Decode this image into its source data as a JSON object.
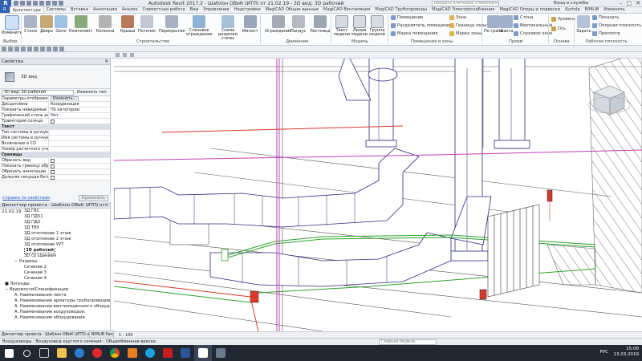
{
  "titlebar": {
    "title": "Autodesk Revit 2017.2 -   Шаблон ОВиК (ИТП) от 21.02.19 - 3D вид: 3D рабочий",
    "search_placeholder": "Введите ключевое слово/фразу",
    "login": "Вход в службы"
  },
  "tabs": [
    "Архитектура",
    "Системы",
    "Вставка",
    "Аннотации",
    "Анализ",
    "Совместная работа",
    "Вид",
    "Управление",
    "Надстройки",
    "MagiCAD Общие данные",
    "MagiCAD Вентиляция",
    "MagiCAD Трубопроводы",
    "MagiCAD Электроснабжение",
    "MagiCAD Опоры и подвески",
    "Kurtolp",
    "BIMLIB",
    "Изменить"
  ],
  "ribbon": {
    "modify": "Изменить",
    "build": [
      "Стена",
      "Дверь",
      "Окно",
      "Компонент",
      "Колонна",
      "Крыша",
      "Потолок",
      "Перекрытие",
      "Стеновое ограждение",
      "Схема разрезки стены",
      "Импост"
    ],
    "move": [
      "Ограждение",
      "Пандус",
      "Лестница"
    ],
    "model": [
      "Текст модели",
      "Линия модели",
      "Группа модели"
    ],
    "rooms_small": [
      "Помещение",
      "Разделитель помещений",
      "Марка помещения",
      "Зона",
      "Граница зоны",
      "Марка зоны"
    ],
    "opening": [
      "По грани",
      "Шахта"
    ],
    "opening_small": [
      "Стена",
      "Вертикальный",
      "Слуховое окно"
    ],
    "datum": [
      "Уровень",
      "Ось"
    ],
    "workplane": [
      "Задать",
      "Показать",
      "Опорная плоскость",
      "Просмотр"
    ],
    "panel_labels": [
      "Выбор",
      "Строительство",
      "Движение",
      "Модель",
      "Помещения и зоны",
      "Проем",
      "Основа",
      "Рабочая плоскость"
    ]
  },
  "properties": {
    "header": "Свойства",
    "type_name": "3D вид",
    "selector": "3D вид: 3D рабочий",
    "edit_type": "Изменить тип",
    "rows": [
      {
        "k": "Параметры отображен...",
        "v": "Изменить...",
        "kind": "btn"
      },
      {
        "k": "Дисциплина",
        "v": "Координация"
      },
      {
        "k": "Показать невидимые ли...",
        "v": "По категории"
      },
      {
        "k": "Графический стиль рас...",
        "v": "Нет"
      },
      {
        "k": "Траектория солнца",
        "v": "",
        "kind": "cb"
      },
      {
        "k": "Текст",
        "v": "",
        "kind": "grp"
      },
      {
        "k": "Тип системы в ручную",
        "v": ""
      },
      {
        "k": "Имя системы в ручную",
        "v": ""
      },
      {
        "k": "Включение в СО",
        "v": ""
      },
      {
        "k": "Номер расчетного учас...",
        "v": ""
      },
      {
        "k": "Границы",
        "v": "",
        "kind": "grp"
      },
      {
        "k": "Обрезать вид",
        "v": "",
        "kind": "cb"
      },
      {
        "k": "Показать границу обре...",
        "v": "",
        "kind": "cb"
      },
      {
        "k": "Обрезать аннотации",
        "v": "",
        "kind": "cb"
      },
      {
        "k": "Дальняя секущая Вкл",
        "v": "",
        "kind": "cb"
      }
    ],
    "help_link": "Справка по свойствам",
    "apply": "Применить"
  },
  "browser": {
    "header": "Диспетчер проекта - Шаблон ОВиК (ИТП) от 21.02.19",
    "items": [
      {
        "t": "3Д ГВС",
        "lvl": 3
      },
      {
        "t": "3Д ПД51",
        "lvl": 3
      },
      {
        "t": "3Д ПД2",
        "lvl": 3
      },
      {
        "t": "3Д ТВУ",
        "lvl": 3
      },
      {
        "t": "3Д отопление 1 этаж",
        "lvl": 3
      },
      {
        "t": "3Д отопление 2 этаж",
        "lvl": 3
      },
      {
        "t": "3Д отопление УУТ",
        "lvl": 3
      },
      {
        "t": "3D рабочий",
        "lvl": 3,
        "sel": true
      },
      {
        "t": "3D со зданием",
        "lvl": 3
      },
      {
        "t": "Разрезы",
        "lvl": 2,
        "toggle": "−"
      },
      {
        "t": "Сечение 2",
        "lvl": 3
      },
      {
        "t": "Сечение 3",
        "lvl": 3
      },
      {
        "t": "Сечение 4",
        "lvl": 3
      },
      {
        "t": "Легенды",
        "lvl": 1,
        "toggle": "■"
      },
      {
        "t": "Ведомости/Спецификации",
        "lvl": 1,
        "toggle": "−"
      },
      {
        "t": "А. Наименование листа",
        "lvl": 2
      },
      {
        "t": "А. Наименование арматуры трубопроводов.",
        "lvl": 2
      },
      {
        "t": "А. Наименование вентиляционного оборудо...",
        "lvl": 2
      },
      {
        "t": "А. Наименование воздуховодов.",
        "lvl": 2
      },
      {
        "t": "А. Наименование оборудования.",
        "lvl": 2
      }
    ]
  },
  "bottom_tabs": [
    "Диспетчер проекта - Шаблон ОВиК (ИТП) от 21.02.19",
    "BIMLIB Panel"
  ],
  "view_control": "1 : 100",
  "status": {
    "text": "Воздуховоды : Воздуховод круглого сечения : Общеобменная вреска",
    "center": "Главная модель"
  },
  "tray": {
    "lang": "РУС",
    "time": "15:08",
    "date": "13.03.2019"
  },
  "colors": {
    "file_tab": "#2e61b4",
    "duct": "#2a2a80",
    "pipe_green": "#2ca02c",
    "pipe_red": "#d93a2a",
    "pipe_magenta": "#c63dbd"
  }
}
